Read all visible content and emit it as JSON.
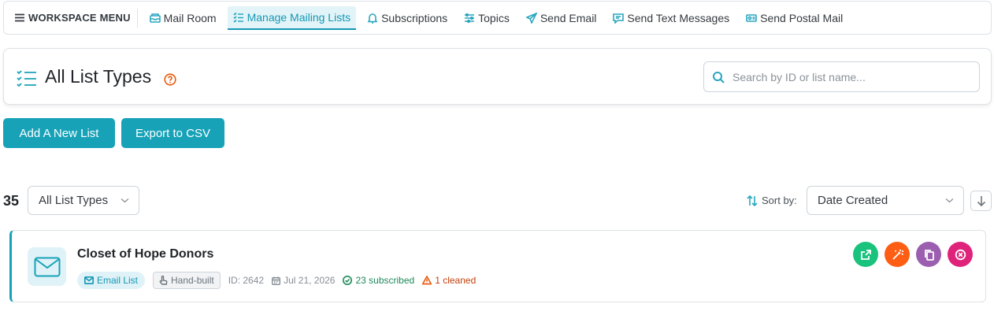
{
  "colors": {
    "accent": "#17a2b8",
    "open": "#19c37d",
    "magic": "#fd5e14",
    "copy": "#9c5fb0",
    "delete": "#e0237a"
  },
  "nav": {
    "workspace_menu": "WORKSPACE MENU",
    "items": [
      {
        "label": "Mail Room",
        "icon": "mailroom-icon"
      },
      {
        "label": "Manage Mailing Lists",
        "icon": "list-check-icon",
        "active": true
      },
      {
        "label": "Subscriptions",
        "icon": "bell-icon"
      },
      {
        "label": "Topics",
        "icon": "sliders-icon"
      },
      {
        "label": "Send Email",
        "icon": "paper-plane-icon"
      },
      {
        "label": "Send Text Messages",
        "icon": "message-icon"
      },
      {
        "label": "Send Postal Mail",
        "icon": "postal-icon"
      }
    ]
  },
  "header": {
    "title": "All List Types",
    "search_placeholder": "Search by ID or list name..."
  },
  "buttons": {
    "add": "Add A New List",
    "export": "Export to CSV"
  },
  "filters": {
    "count": "35",
    "list_type": "All List Types",
    "sort_label": "Sort by:",
    "sort_value": "Date Created"
  },
  "lists": [
    {
      "name": "Closet of Hope Donors",
      "type_badge": "Email List",
      "build_badge": "Hand-built",
      "id": "ID: 2642",
      "date": "Jul 21, 2026",
      "subscribed": "23 subscribed",
      "cleaned": "1 cleaned"
    }
  ]
}
